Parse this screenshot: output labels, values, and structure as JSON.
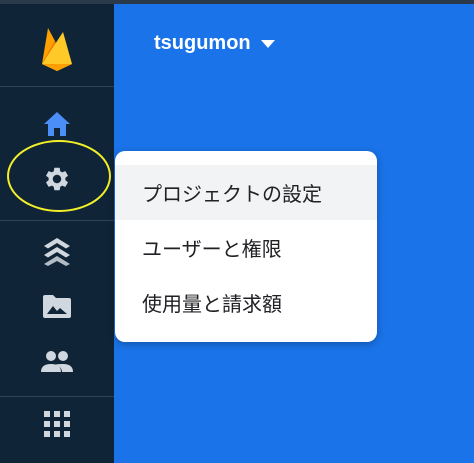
{
  "header": {
    "project_name": "tsugumon"
  },
  "sidebar": {
    "items": [
      {
        "icon": "firebase-logo-icon"
      },
      {
        "icon": "home-icon"
      },
      {
        "icon": "gear-icon"
      },
      {
        "icon": "build-icon"
      },
      {
        "icon": "storage-icon"
      },
      {
        "icon": "users-icon"
      },
      {
        "icon": "apps-grid-icon"
      }
    ]
  },
  "settings_menu": {
    "items": [
      {
        "label": "プロジェクトの設定",
        "active": true
      },
      {
        "label": "ユーザーと権限",
        "active": false
      },
      {
        "label": "使用量と請求額",
        "active": false
      }
    ]
  },
  "colors": {
    "sidebar_bg": "#0f2537",
    "main_bg": "#1a73e8",
    "highlight_ring": "#f4ef28",
    "firebase_yellow": "#ffca28",
    "firebase_orange": "#f57c00"
  }
}
